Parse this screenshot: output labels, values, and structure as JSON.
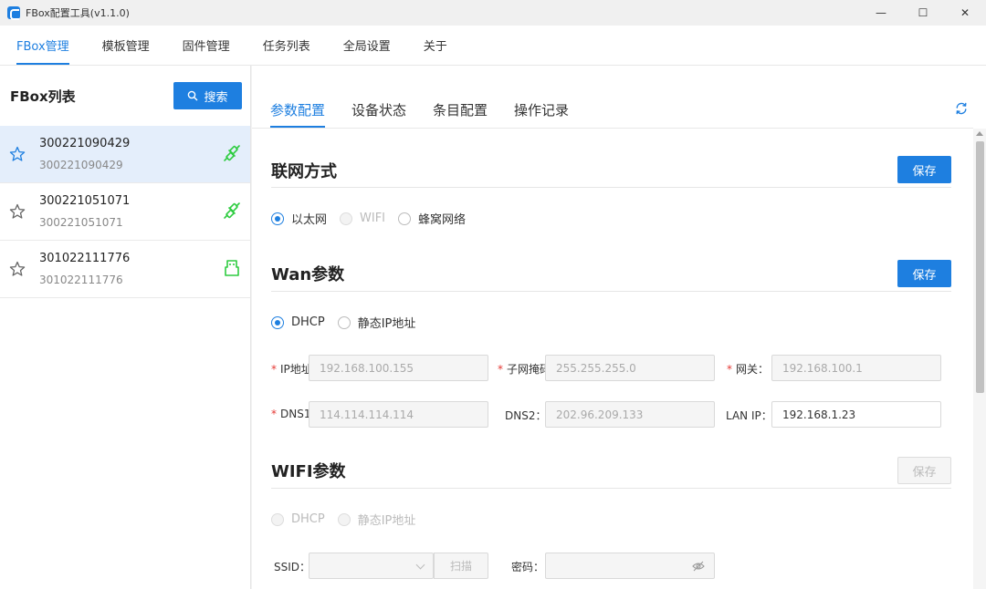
{
  "window": {
    "title": "FBox配置工具(v1.1.0)",
    "minimize": "—",
    "maximize": "☐",
    "close": "✕"
  },
  "menu": [
    "FBox管理",
    "模板管理",
    "固件管理",
    "任务列表",
    "全局设置",
    "关于"
  ],
  "sidebar": {
    "title": "FBox列表",
    "search_label": "搜索",
    "devices": [
      {
        "name": "300221090429",
        "sub": "300221090429",
        "status": "connected-icon"
      },
      {
        "name": "300221051071",
        "sub": "300221051071",
        "status": "connected-icon"
      },
      {
        "name": "301022111776",
        "sub": "301022111776",
        "status": "usb-icon"
      }
    ]
  },
  "tabs": [
    "参数配置",
    "设备状态",
    "条目配置",
    "操作记录"
  ],
  "sections": {
    "network": {
      "title": "联网方式",
      "save": "保存",
      "options": [
        "以太网",
        "WIFI",
        "蜂窝网络"
      ]
    },
    "wan": {
      "title": "Wan参数",
      "save": "保存",
      "options": [
        "DHCP",
        "静态IP地址"
      ],
      "ip_label": "IP地址",
      "ip_value": "192.168.100.155",
      "mask_label": "子网掩码",
      "mask_value": "255.255.255.0",
      "gateway_label": "网关：",
      "gateway_value": "192.168.100.1",
      "dns1_label": "DNS1",
      "dns1_value": "114.114.114.114",
      "dns2_label": "DNS2：",
      "dns2_value": "202.96.209.133",
      "lanip_label": "LAN IP：",
      "lanip_value": "192.168.1.23"
    },
    "wifi": {
      "title": "WIFI参数",
      "save": "保存",
      "options": [
        "DHCP",
        "静态IP地址"
      ],
      "ssid_label": "SSID：",
      "scan": "扫描",
      "password_label": "密码："
    }
  },
  "colors": {
    "accent": "#1e7fe0",
    "connected": "#2ecc40",
    "required": "#e53935"
  }
}
